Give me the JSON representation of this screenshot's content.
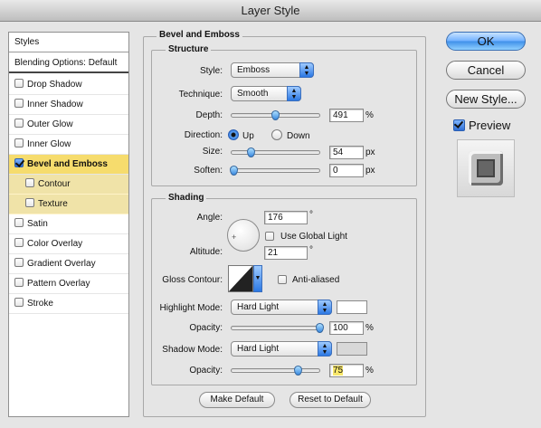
{
  "window": {
    "title": "Layer Style"
  },
  "styles_list": {
    "header": "Styles",
    "blending": "Blending Options: Default",
    "items": [
      {
        "label": "Drop Shadow",
        "checked": false
      },
      {
        "label": "Inner Shadow",
        "checked": false
      },
      {
        "label": "Outer Glow",
        "checked": false
      },
      {
        "label": "Inner Glow",
        "checked": false
      },
      {
        "label": "Bevel and Emboss",
        "checked": true
      },
      {
        "label": "Contour",
        "checked": false
      },
      {
        "label": "Texture",
        "checked": false
      },
      {
        "label": "Satin",
        "checked": false
      },
      {
        "label": "Color Overlay",
        "checked": false
      },
      {
        "label": "Gradient Overlay",
        "checked": false
      },
      {
        "label": "Pattern Overlay",
        "checked": false
      },
      {
        "label": "Stroke",
        "checked": false
      }
    ]
  },
  "panel": {
    "title": "Bevel and Emboss",
    "structure": {
      "title": "Structure",
      "style_label": "Style:",
      "style_value": "Emboss",
      "technique_label": "Technique:",
      "technique_value": "Smooth",
      "depth_label": "Depth:",
      "depth_value": "491",
      "depth_unit": "%",
      "depth_fraction": 0.49,
      "direction_label": "Direction:",
      "direction_up": "Up",
      "direction_down": "Down",
      "direction_selected": "Up",
      "size_label": "Size:",
      "size_value": "54",
      "size_unit": "px",
      "size_fraction": 0.22,
      "soften_label": "Soften:",
      "soften_value": "0",
      "soften_unit": "px",
      "soften_fraction": 0.0
    },
    "shading": {
      "title": "Shading",
      "angle_label": "Angle:",
      "angle_value": "176",
      "angle_unit": "°",
      "global_light_label": "Use Global Light",
      "altitude_label": "Altitude:",
      "altitude_value": "21",
      "altitude_unit": "°",
      "gloss_contour_label": "Gloss Contour:",
      "anti_aliased_label": "Anti-aliased",
      "highlight_mode_label": "Highlight Mode:",
      "highlight_mode_value": "Hard Light",
      "highlight_color": "#ffffff",
      "highlight_opacity_label": "Opacity:",
      "highlight_opacity_value": "100",
      "highlight_opacity_unit": "%",
      "highlight_opacity_fraction": 1.0,
      "shadow_mode_label": "Shadow Mode:",
      "shadow_mode_value": "Hard Light",
      "shadow_color": "#d8d8d8",
      "shadow_opacity_label": "Opacity:",
      "shadow_opacity_value": "75",
      "shadow_opacity_unit": "%",
      "shadow_opacity_fraction": 0.75
    },
    "make_default": "Make Default",
    "reset_default": "Reset to Default"
  },
  "buttons": {
    "ok": "OK",
    "cancel": "Cancel",
    "new_style": "New Style...",
    "preview_label": "Preview",
    "preview_checked": true
  }
}
